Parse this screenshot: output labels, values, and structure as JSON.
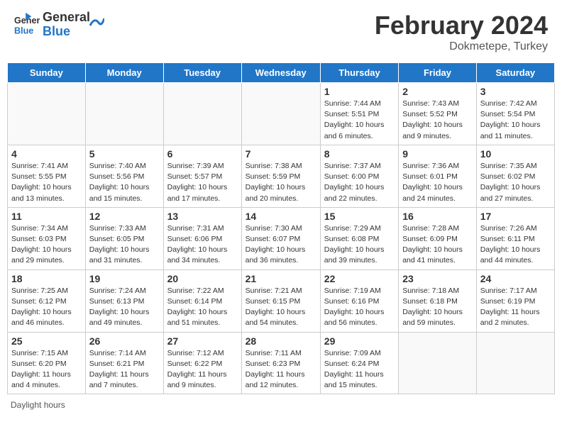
{
  "header": {
    "logo_line1": "General",
    "logo_line2": "Blue",
    "month_title": "February 2024",
    "location": "Dokmetepe, Turkey"
  },
  "footer": {
    "label": "Daylight hours"
  },
  "weekdays": [
    "Sunday",
    "Monday",
    "Tuesday",
    "Wednesday",
    "Thursday",
    "Friday",
    "Saturday"
  ],
  "weeks": [
    [
      {
        "day": "",
        "info": ""
      },
      {
        "day": "",
        "info": ""
      },
      {
        "day": "",
        "info": ""
      },
      {
        "day": "",
        "info": ""
      },
      {
        "day": "1",
        "info": "Sunrise: 7:44 AM\nSunset: 5:51 PM\nDaylight: 10 hours and 6 minutes."
      },
      {
        "day": "2",
        "info": "Sunrise: 7:43 AM\nSunset: 5:52 PM\nDaylight: 10 hours and 9 minutes."
      },
      {
        "day": "3",
        "info": "Sunrise: 7:42 AM\nSunset: 5:54 PM\nDaylight: 10 hours and 11 minutes."
      }
    ],
    [
      {
        "day": "4",
        "info": "Sunrise: 7:41 AM\nSunset: 5:55 PM\nDaylight: 10 hours and 13 minutes."
      },
      {
        "day": "5",
        "info": "Sunrise: 7:40 AM\nSunset: 5:56 PM\nDaylight: 10 hours and 15 minutes."
      },
      {
        "day": "6",
        "info": "Sunrise: 7:39 AM\nSunset: 5:57 PM\nDaylight: 10 hours and 17 minutes."
      },
      {
        "day": "7",
        "info": "Sunrise: 7:38 AM\nSunset: 5:59 PM\nDaylight: 10 hours and 20 minutes."
      },
      {
        "day": "8",
        "info": "Sunrise: 7:37 AM\nSunset: 6:00 PM\nDaylight: 10 hours and 22 minutes."
      },
      {
        "day": "9",
        "info": "Sunrise: 7:36 AM\nSunset: 6:01 PM\nDaylight: 10 hours and 24 minutes."
      },
      {
        "day": "10",
        "info": "Sunrise: 7:35 AM\nSunset: 6:02 PM\nDaylight: 10 hours and 27 minutes."
      }
    ],
    [
      {
        "day": "11",
        "info": "Sunrise: 7:34 AM\nSunset: 6:03 PM\nDaylight: 10 hours and 29 minutes."
      },
      {
        "day": "12",
        "info": "Sunrise: 7:33 AM\nSunset: 6:05 PM\nDaylight: 10 hours and 31 minutes."
      },
      {
        "day": "13",
        "info": "Sunrise: 7:31 AM\nSunset: 6:06 PM\nDaylight: 10 hours and 34 minutes."
      },
      {
        "day": "14",
        "info": "Sunrise: 7:30 AM\nSunset: 6:07 PM\nDaylight: 10 hours and 36 minutes."
      },
      {
        "day": "15",
        "info": "Sunrise: 7:29 AM\nSunset: 6:08 PM\nDaylight: 10 hours and 39 minutes."
      },
      {
        "day": "16",
        "info": "Sunrise: 7:28 AM\nSunset: 6:09 PM\nDaylight: 10 hours and 41 minutes."
      },
      {
        "day": "17",
        "info": "Sunrise: 7:26 AM\nSunset: 6:11 PM\nDaylight: 10 hours and 44 minutes."
      }
    ],
    [
      {
        "day": "18",
        "info": "Sunrise: 7:25 AM\nSunset: 6:12 PM\nDaylight: 10 hours and 46 minutes."
      },
      {
        "day": "19",
        "info": "Sunrise: 7:24 AM\nSunset: 6:13 PM\nDaylight: 10 hours and 49 minutes."
      },
      {
        "day": "20",
        "info": "Sunrise: 7:22 AM\nSunset: 6:14 PM\nDaylight: 10 hours and 51 minutes."
      },
      {
        "day": "21",
        "info": "Sunrise: 7:21 AM\nSunset: 6:15 PM\nDaylight: 10 hours and 54 minutes."
      },
      {
        "day": "22",
        "info": "Sunrise: 7:19 AM\nSunset: 6:16 PM\nDaylight: 10 hours and 56 minutes."
      },
      {
        "day": "23",
        "info": "Sunrise: 7:18 AM\nSunset: 6:18 PM\nDaylight: 10 hours and 59 minutes."
      },
      {
        "day": "24",
        "info": "Sunrise: 7:17 AM\nSunset: 6:19 PM\nDaylight: 11 hours and 2 minutes."
      }
    ],
    [
      {
        "day": "25",
        "info": "Sunrise: 7:15 AM\nSunset: 6:20 PM\nDaylight: 11 hours and 4 minutes."
      },
      {
        "day": "26",
        "info": "Sunrise: 7:14 AM\nSunset: 6:21 PM\nDaylight: 11 hours and 7 minutes."
      },
      {
        "day": "27",
        "info": "Sunrise: 7:12 AM\nSunset: 6:22 PM\nDaylight: 11 hours and 9 minutes."
      },
      {
        "day": "28",
        "info": "Sunrise: 7:11 AM\nSunset: 6:23 PM\nDaylight: 11 hours and 12 minutes."
      },
      {
        "day": "29",
        "info": "Sunrise: 7:09 AM\nSunset: 6:24 PM\nDaylight: 11 hours and 15 minutes."
      },
      {
        "day": "",
        "info": ""
      },
      {
        "day": "",
        "info": ""
      }
    ]
  ]
}
